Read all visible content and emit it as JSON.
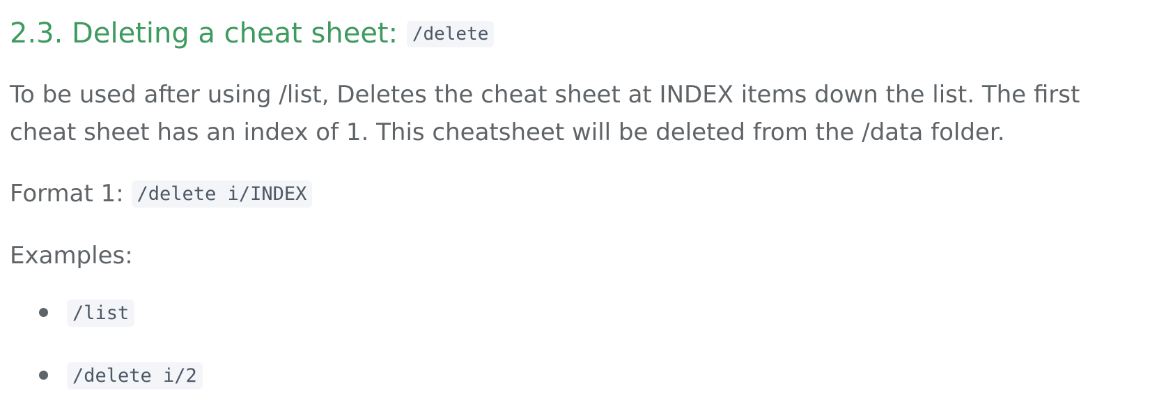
{
  "section": {
    "heading_text": "2.3. Deleting a cheat sheet:",
    "heading_command": "/delete",
    "description": "To be used after using /list, Deletes the cheat sheet at INDEX items down the list. The first cheat sheet has an index of 1. This cheatsheet will be deleted from the /data folder.",
    "format_label": "Format 1:",
    "format_command": "/delete i/INDEX",
    "examples_label": "Examples:",
    "examples": [
      "/list",
      "/delete i/2"
    ]
  }
}
